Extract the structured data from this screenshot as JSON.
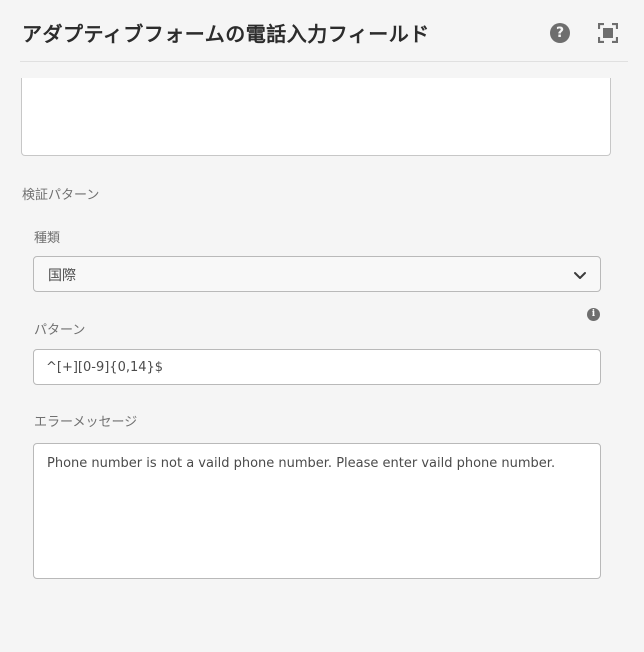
{
  "header": {
    "title": "アダプティブフォームの電話入力フィールド",
    "help_icon_label": "?",
    "help_icon": "help-circle-icon",
    "fullscreen_icon": "fullscreen-icon"
  },
  "validation": {
    "section_label": "検証パターン",
    "type": {
      "label": "種類",
      "selected_value": "国際",
      "icon": "chevron-down-icon"
    },
    "pattern": {
      "label": "パターン",
      "info_icon_label": "i",
      "info_icon": "info-icon",
      "value": "^[+][0-9]{0,14}$"
    },
    "error_message": {
      "label": "エラーメッセージ",
      "value": "Phone number is not a vaild phone number. Please enter vaild phone number."
    }
  },
  "colors": {
    "background": "#f5f5f5",
    "title": "#2c2c2c",
    "icon": "#6e6e6e",
    "border": "#b9b9b9"
  }
}
